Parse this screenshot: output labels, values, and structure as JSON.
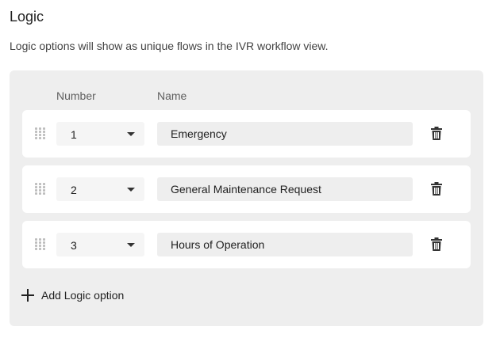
{
  "header": {
    "title": "Logic",
    "subtitle": "Logic options will show as unique flows in the IVR workflow view."
  },
  "table": {
    "columns": {
      "number": "Number",
      "name": "Name"
    },
    "rows": [
      {
        "number": "1",
        "name": "Emergency"
      },
      {
        "number": "2",
        "name": "General Maintenance Request"
      },
      {
        "number": "3",
        "name": "Hours of Operation"
      }
    ]
  },
  "add_option_label": "Add Logic option",
  "icons": {
    "drag": "drag-handle-icon",
    "dropdown": "chevron-down-icon",
    "delete": "trash-icon",
    "add": "plus-icon"
  }
}
